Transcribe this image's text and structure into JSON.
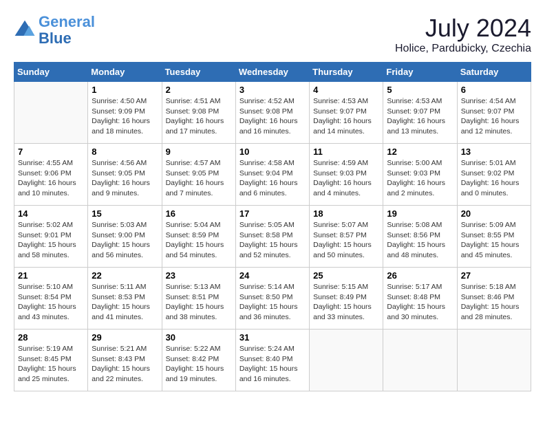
{
  "header": {
    "logo_line1": "General",
    "logo_line2": "Blue",
    "month": "July 2024",
    "location": "Holice, Pardubicky, Czechia"
  },
  "days_of_week": [
    "Sunday",
    "Monday",
    "Tuesday",
    "Wednesday",
    "Thursday",
    "Friday",
    "Saturday"
  ],
  "weeks": [
    [
      {
        "day": "",
        "info": ""
      },
      {
        "day": "1",
        "info": "Sunrise: 4:50 AM\nSunset: 9:09 PM\nDaylight: 16 hours\nand 18 minutes."
      },
      {
        "day": "2",
        "info": "Sunrise: 4:51 AM\nSunset: 9:08 PM\nDaylight: 16 hours\nand 17 minutes."
      },
      {
        "day": "3",
        "info": "Sunrise: 4:52 AM\nSunset: 9:08 PM\nDaylight: 16 hours\nand 16 minutes."
      },
      {
        "day": "4",
        "info": "Sunrise: 4:53 AM\nSunset: 9:07 PM\nDaylight: 16 hours\nand 14 minutes."
      },
      {
        "day": "5",
        "info": "Sunrise: 4:53 AM\nSunset: 9:07 PM\nDaylight: 16 hours\nand 13 minutes."
      },
      {
        "day": "6",
        "info": "Sunrise: 4:54 AM\nSunset: 9:07 PM\nDaylight: 16 hours\nand 12 minutes."
      }
    ],
    [
      {
        "day": "7",
        "info": "Sunrise: 4:55 AM\nSunset: 9:06 PM\nDaylight: 16 hours\nand 10 minutes."
      },
      {
        "day": "8",
        "info": "Sunrise: 4:56 AM\nSunset: 9:05 PM\nDaylight: 16 hours\nand 9 minutes."
      },
      {
        "day": "9",
        "info": "Sunrise: 4:57 AM\nSunset: 9:05 PM\nDaylight: 16 hours\nand 7 minutes."
      },
      {
        "day": "10",
        "info": "Sunrise: 4:58 AM\nSunset: 9:04 PM\nDaylight: 16 hours\nand 6 minutes."
      },
      {
        "day": "11",
        "info": "Sunrise: 4:59 AM\nSunset: 9:03 PM\nDaylight: 16 hours\nand 4 minutes."
      },
      {
        "day": "12",
        "info": "Sunrise: 5:00 AM\nSunset: 9:03 PM\nDaylight: 16 hours\nand 2 minutes."
      },
      {
        "day": "13",
        "info": "Sunrise: 5:01 AM\nSunset: 9:02 PM\nDaylight: 16 hours\nand 0 minutes."
      }
    ],
    [
      {
        "day": "14",
        "info": "Sunrise: 5:02 AM\nSunset: 9:01 PM\nDaylight: 15 hours\nand 58 minutes."
      },
      {
        "day": "15",
        "info": "Sunrise: 5:03 AM\nSunset: 9:00 PM\nDaylight: 15 hours\nand 56 minutes."
      },
      {
        "day": "16",
        "info": "Sunrise: 5:04 AM\nSunset: 8:59 PM\nDaylight: 15 hours\nand 54 minutes."
      },
      {
        "day": "17",
        "info": "Sunrise: 5:05 AM\nSunset: 8:58 PM\nDaylight: 15 hours\nand 52 minutes."
      },
      {
        "day": "18",
        "info": "Sunrise: 5:07 AM\nSunset: 8:57 PM\nDaylight: 15 hours\nand 50 minutes."
      },
      {
        "day": "19",
        "info": "Sunrise: 5:08 AM\nSunset: 8:56 PM\nDaylight: 15 hours\nand 48 minutes."
      },
      {
        "day": "20",
        "info": "Sunrise: 5:09 AM\nSunset: 8:55 PM\nDaylight: 15 hours\nand 45 minutes."
      }
    ],
    [
      {
        "day": "21",
        "info": "Sunrise: 5:10 AM\nSunset: 8:54 PM\nDaylight: 15 hours\nand 43 minutes."
      },
      {
        "day": "22",
        "info": "Sunrise: 5:11 AM\nSunset: 8:53 PM\nDaylight: 15 hours\nand 41 minutes."
      },
      {
        "day": "23",
        "info": "Sunrise: 5:13 AM\nSunset: 8:51 PM\nDaylight: 15 hours\nand 38 minutes."
      },
      {
        "day": "24",
        "info": "Sunrise: 5:14 AM\nSunset: 8:50 PM\nDaylight: 15 hours\nand 36 minutes."
      },
      {
        "day": "25",
        "info": "Sunrise: 5:15 AM\nSunset: 8:49 PM\nDaylight: 15 hours\nand 33 minutes."
      },
      {
        "day": "26",
        "info": "Sunrise: 5:17 AM\nSunset: 8:48 PM\nDaylight: 15 hours\nand 30 minutes."
      },
      {
        "day": "27",
        "info": "Sunrise: 5:18 AM\nSunset: 8:46 PM\nDaylight: 15 hours\nand 28 minutes."
      }
    ],
    [
      {
        "day": "28",
        "info": "Sunrise: 5:19 AM\nSunset: 8:45 PM\nDaylight: 15 hours\nand 25 minutes."
      },
      {
        "day": "29",
        "info": "Sunrise: 5:21 AM\nSunset: 8:43 PM\nDaylight: 15 hours\nand 22 minutes."
      },
      {
        "day": "30",
        "info": "Sunrise: 5:22 AM\nSunset: 8:42 PM\nDaylight: 15 hours\nand 19 minutes."
      },
      {
        "day": "31",
        "info": "Sunrise: 5:24 AM\nSunset: 8:40 PM\nDaylight: 15 hours\nand 16 minutes."
      },
      {
        "day": "",
        "info": ""
      },
      {
        "day": "",
        "info": ""
      },
      {
        "day": "",
        "info": ""
      }
    ]
  ]
}
